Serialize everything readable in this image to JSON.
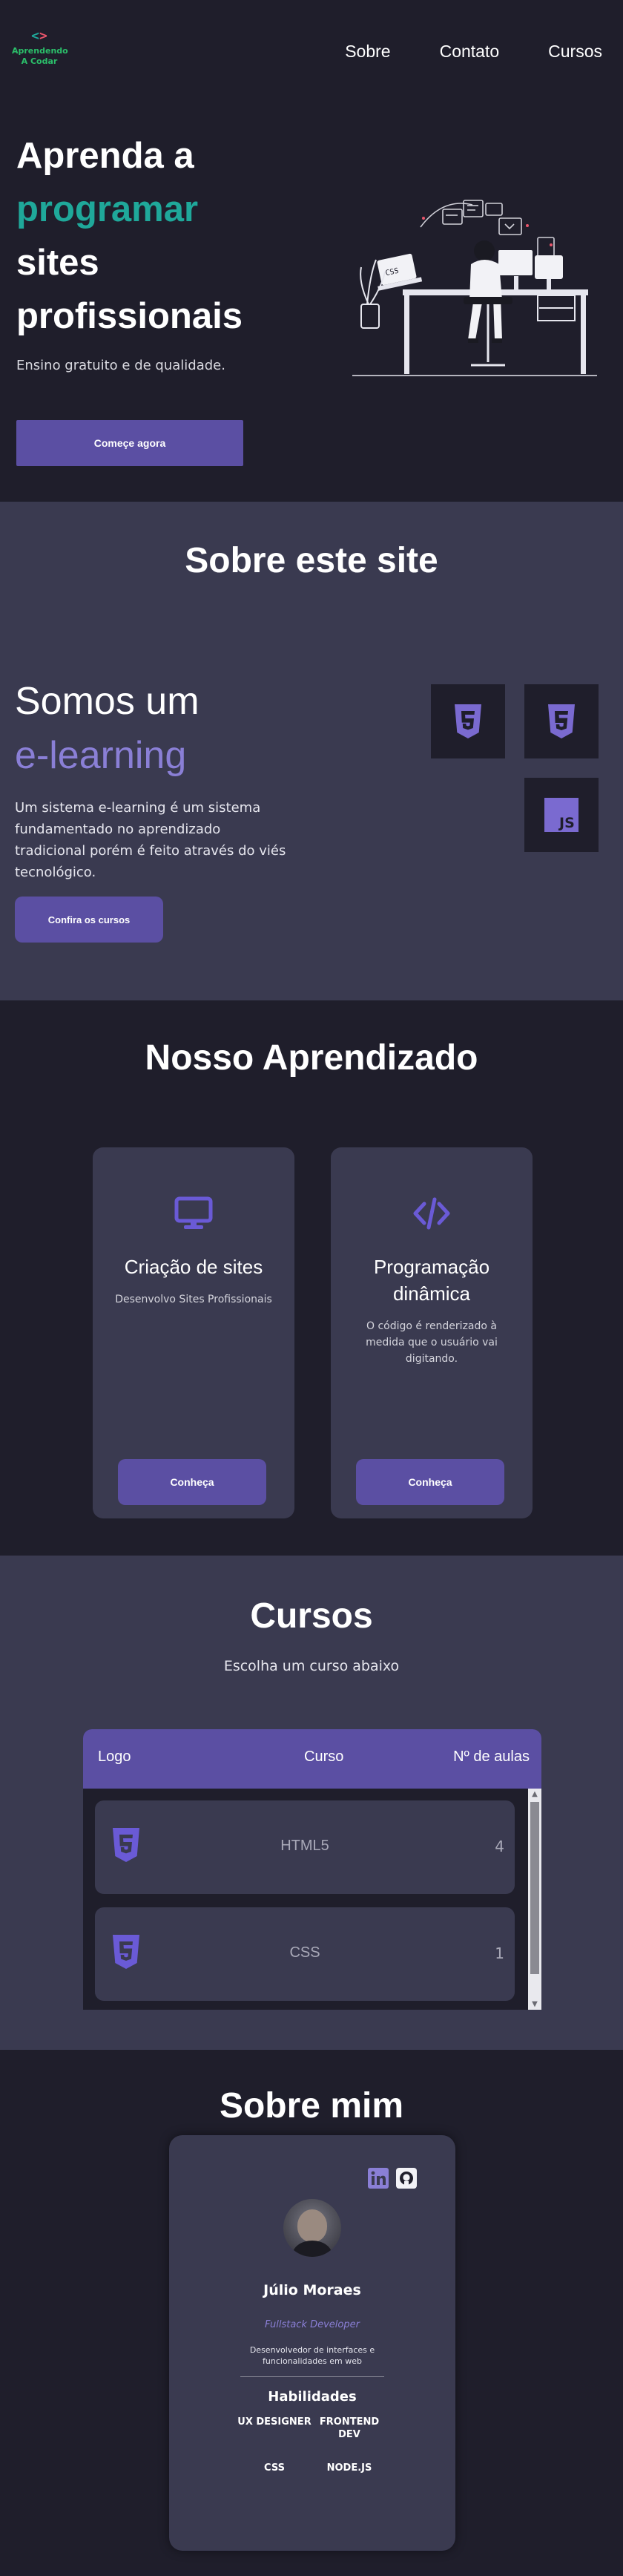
{
  "brand": {
    "mark_left": "<",
    "mark_right": ">",
    "line1": "Aprendendo",
    "line2": "A Codar"
  },
  "nav": {
    "items": [
      "Sobre",
      "Contato",
      "Cursos"
    ]
  },
  "hero": {
    "title_line1": "Aprenda a",
    "title_line2": "programar",
    "title_line3": "sites",
    "title_line4": "profissionais",
    "subtitle": "Ensino gratuito e de qualidade.",
    "cta": "Começe agora",
    "illustration_text": "CSS"
  },
  "about": {
    "title": "Sobre este site",
    "heading_line1": "Somos um",
    "heading_line2": "e-learning",
    "description": "Um sistema e-learning é um sistema fundamentado no aprendizado tradicional porém é feito através do viés tecnológico.",
    "cta": "Confira os cursos",
    "tech_icons": [
      "html5-icon",
      "css3-icon",
      "js-icon"
    ],
    "js_label": "JS"
  },
  "learning": {
    "title": "Nosso Aprendizado",
    "cards": [
      {
        "icon": "monitor-icon",
        "title": "Criação de sites",
        "description": "Desenvolvo Sites Profissionais",
        "button": "Conheça"
      },
      {
        "icon": "code-icon",
        "title": "Programação dinâmica",
        "description": "O código é renderizado à medida que o usuário vai digitando.",
        "button": "Conheça"
      }
    ]
  },
  "courses": {
    "title": "Cursos",
    "subtitle": "Escolha um curso abaixo",
    "headers": {
      "logo": "Logo",
      "course": "Curso",
      "lessons": "Nº de aulas"
    },
    "rows": [
      {
        "icon": "html5-icon",
        "name": "HTML5",
        "lessons": "4"
      },
      {
        "icon": "css3-icon",
        "name": "CSS",
        "lessons": "1"
      }
    ]
  },
  "me": {
    "title": "Sobre mim",
    "social": [
      "linkedin-icon",
      "github-icon"
    ],
    "name": "Júlio Moraes",
    "role": "Fullstack Developer",
    "description": "Desenvolvedor de interfaces e funcionalidades em web",
    "skills_title": "Habilidades",
    "skills": [
      "UX DESIGNER",
      "FRONTEND DEV",
      "CSS",
      "NODE.JS"
    ]
  },
  "colors": {
    "accent_teal": "#1fa89a",
    "accent_purple": "#5b4fa3",
    "light_purple": "#8a7fd6",
    "bg_dark": "#1f1e2b",
    "bg_mid": "#3a3a50"
  }
}
